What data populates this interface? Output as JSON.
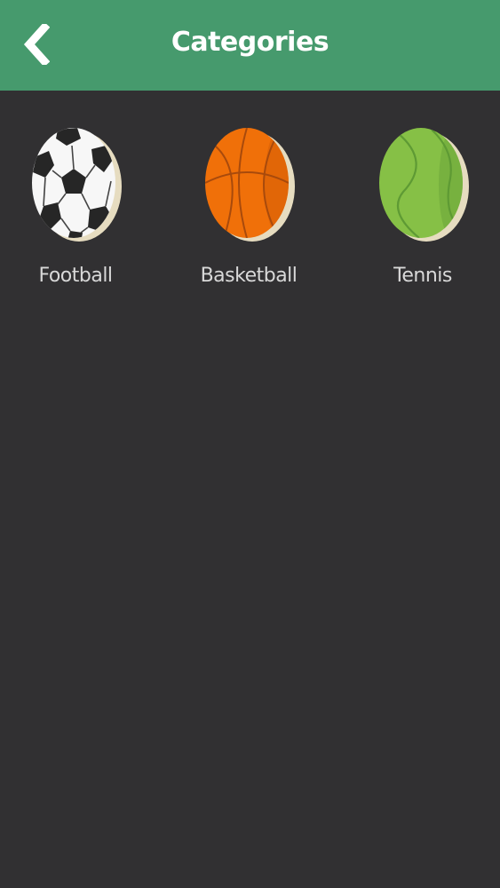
{
  "header": {
    "title": "Categories"
  },
  "colors": {
    "header_bg": "#469a6d",
    "body_bg": "#313032",
    "label_text": "#d8d8d8"
  },
  "categories": [
    {
      "label": "Football",
      "icon": "soccer-ball-icon"
    },
    {
      "label": "Basketball",
      "icon": "basketball-icon"
    },
    {
      "label": "Tennis",
      "icon": "tennis-ball-icon"
    }
  ]
}
